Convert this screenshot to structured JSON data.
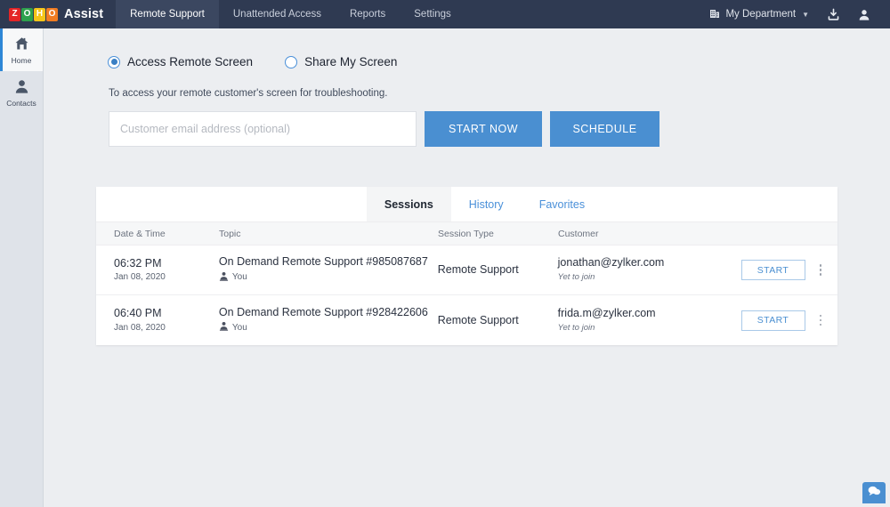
{
  "header": {
    "logo_letters": [
      "Z",
      "O",
      "H",
      "O"
    ],
    "brand_name": "Assist",
    "nav": [
      {
        "label": "Remote Support",
        "active": true
      },
      {
        "label": "Unattended Access",
        "active": false
      },
      {
        "label": "Reports",
        "active": false
      },
      {
        "label": "Settings",
        "active": false
      }
    ],
    "department": "My Department",
    "department_icon": "building-icon",
    "chevron": "▼",
    "download_icon": "download-icon",
    "account_icon": "user-account-icon"
  },
  "sidebar": {
    "items": [
      {
        "label": "Home",
        "icon": "home-icon",
        "active": true
      },
      {
        "label": "Contacts",
        "icon": "contacts-icon",
        "active": false
      }
    ]
  },
  "main": {
    "radio_options": [
      {
        "label": "Access Remote Screen",
        "selected": true
      },
      {
        "label": "Share My Screen",
        "selected": false
      }
    ],
    "description": "To access your remote customer's screen for troubleshooting.",
    "email_placeholder": "Customer email address (optional)",
    "email_value": "",
    "start_now_label": "START NOW",
    "schedule_label": "SCHEDULE"
  },
  "card": {
    "tabs": [
      {
        "label": "Sessions",
        "active": true
      },
      {
        "label": "History",
        "active": false
      },
      {
        "label": "Favorites",
        "active": false
      }
    ],
    "columns": [
      "Date & Time",
      "Topic",
      "Session Type",
      "Customer"
    ],
    "rows": [
      {
        "time": "06:32 PM",
        "date": "Jan 08, 2020",
        "topic": "On Demand Remote Support #985087687",
        "host_icon": "presenter-icon",
        "host": "You",
        "session_type": "Remote Support",
        "customer": "jonathan@zylker.com",
        "customer_status": "Yet to join",
        "action_label": "START",
        "menu_icon": "kebab-menu-icon"
      },
      {
        "time": "06:40 PM",
        "date": "Jan 08, 2020",
        "topic": "On Demand Remote Support #928422606",
        "host_icon": "presenter-icon",
        "host": "You",
        "session_type": "Remote Support",
        "customer": "frida.m@zylker.com",
        "customer_status": "Yet to join",
        "action_label": "START",
        "menu_icon": "kebab-menu-icon"
      }
    ]
  },
  "chat": {
    "icon": "chat-bubble-icon"
  },
  "colors": {
    "header_bg": "#2f3a52",
    "accent_blue": "#4a8fd1",
    "link_blue": "#4a90d9",
    "page_bg": "#eceef1",
    "sidebar_bg": "#dfe3e9"
  }
}
